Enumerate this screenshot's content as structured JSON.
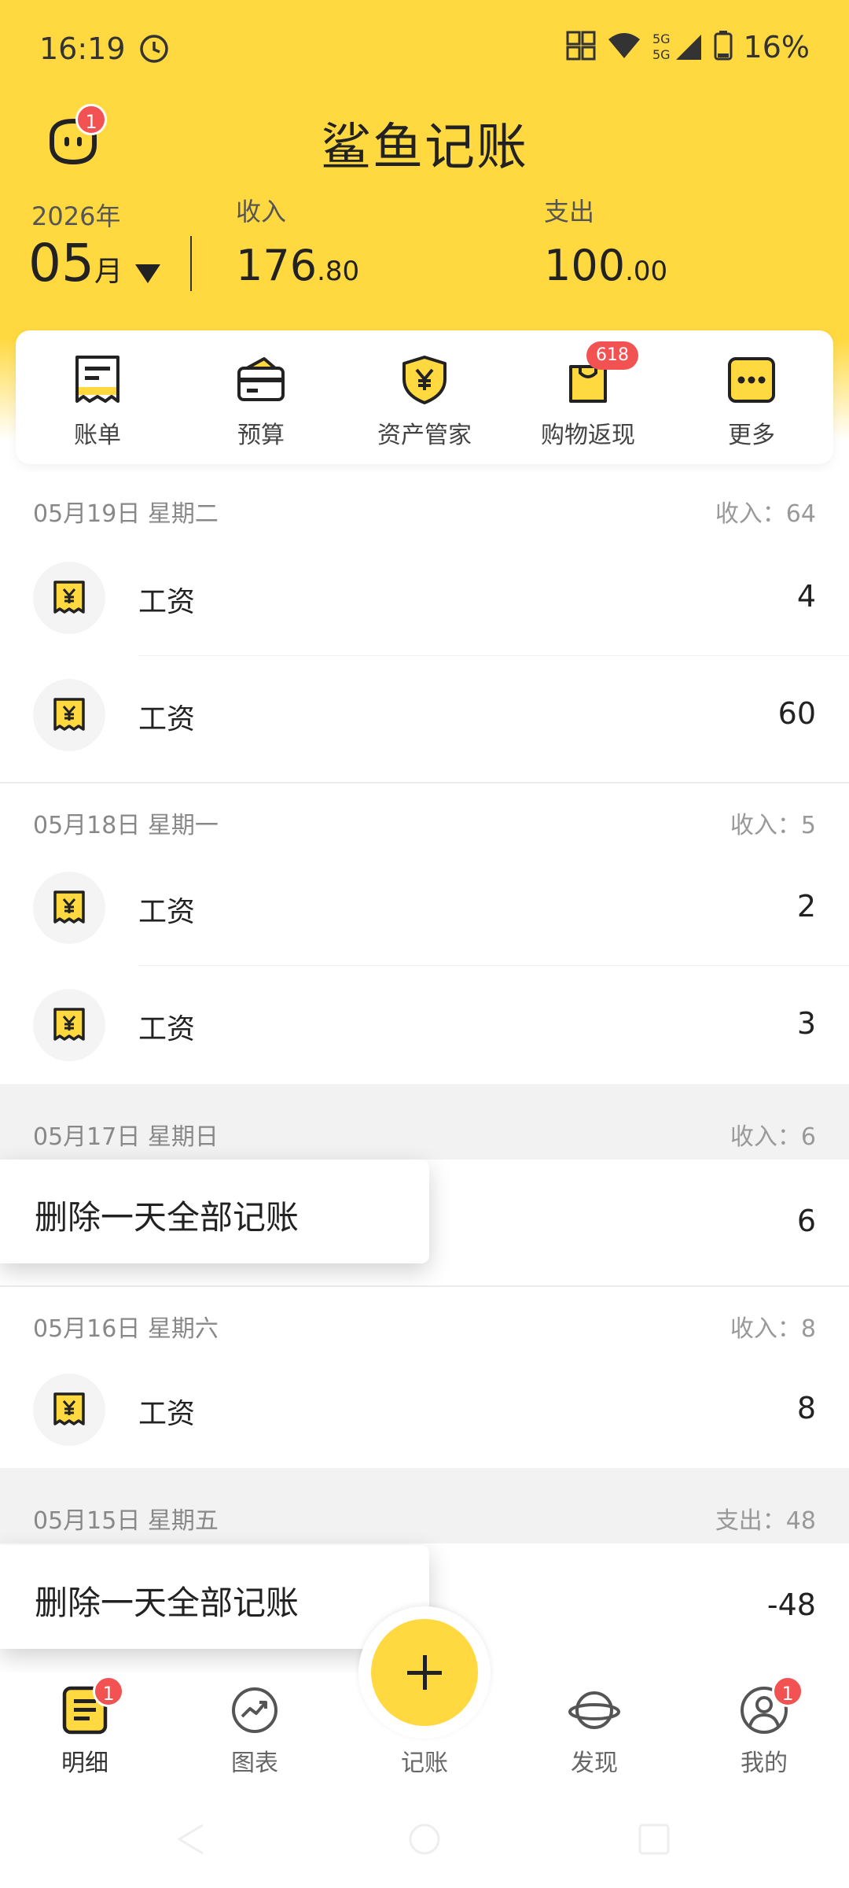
{
  "status_bar": {
    "time": "16:19",
    "battery": "16%",
    "network": "5G"
  },
  "header": {
    "title": "鲨鱼记账",
    "notify_badge": "1",
    "year": "2026年",
    "month": "05",
    "month_unit": "月",
    "income_label": "收入",
    "income_int": "176",
    "income_dec": ".80",
    "expense_label": "支出",
    "expense_int": "100",
    "expense_dec": ".00"
  },
  "quick_menu": [
    {
      "label": "账单",
      "icon": "bill-icon"
    },
    {
      "label": "预算",
      "icon": "wallet-icon"
    },
    {
      "label": "资产管家",
      "icon": "shield-yen-icon"
    },
    {
      "label": "购物返现",
      "icon": "shopping-bag-icon",
      "badge": "618"
    },
    {
      "label": "更多",
      "icon": "more-icon"
    }
  ],
  "days": [
    {
      "date": "05月19日 星期二",
      "summary": "收入：64",
      "entries": [
        {
          "name": "工资",
          "amount": "4"
        },
        {
          "name": "工资",
          "amount": "60"
        }
      ]
    },
    {
      "date": "05月18日 星期一",
      "summary": "收入：5",
      "entries": [
        {
          "name": "工资",
          "amount": "2"
        },
        {
          "name": "工资",
          "amount": "3"
        }
      ]
    },
    {
      "date": "05月17日 星期日",
      "summary": "收入：6",
      "entries": [
        {
          "amount": "6"
        }
      ]
    },
    {
      "date": "05月16日 星期六",
      "summary": "收入：8",
      "entries": [
        {
          "name": "工资",
          "amount": "8"
        }
      ]
    },
    {
      "date": "05月15日 星期五",
      "summary": "支出：48",
      "entries": [
        {
          "amount": "-48"
        }
      ]
    }
  ],
  "popup_label": "删除一天全部记账",
  "bottom_nav": {
    "items": [
      {
        "label": "明细",
        "badge": "1"
      },
      {
        "label": "图表"
      },
      {
        "label": "记账"
      },
      {
        "label": "发现"
      },
      {
        "label": "我的",
        "badge": "1"
      }
    ]
  },
  "colors": {
    "accent": "#FFD93F",
    "badge": "#F25252"
  }
}
